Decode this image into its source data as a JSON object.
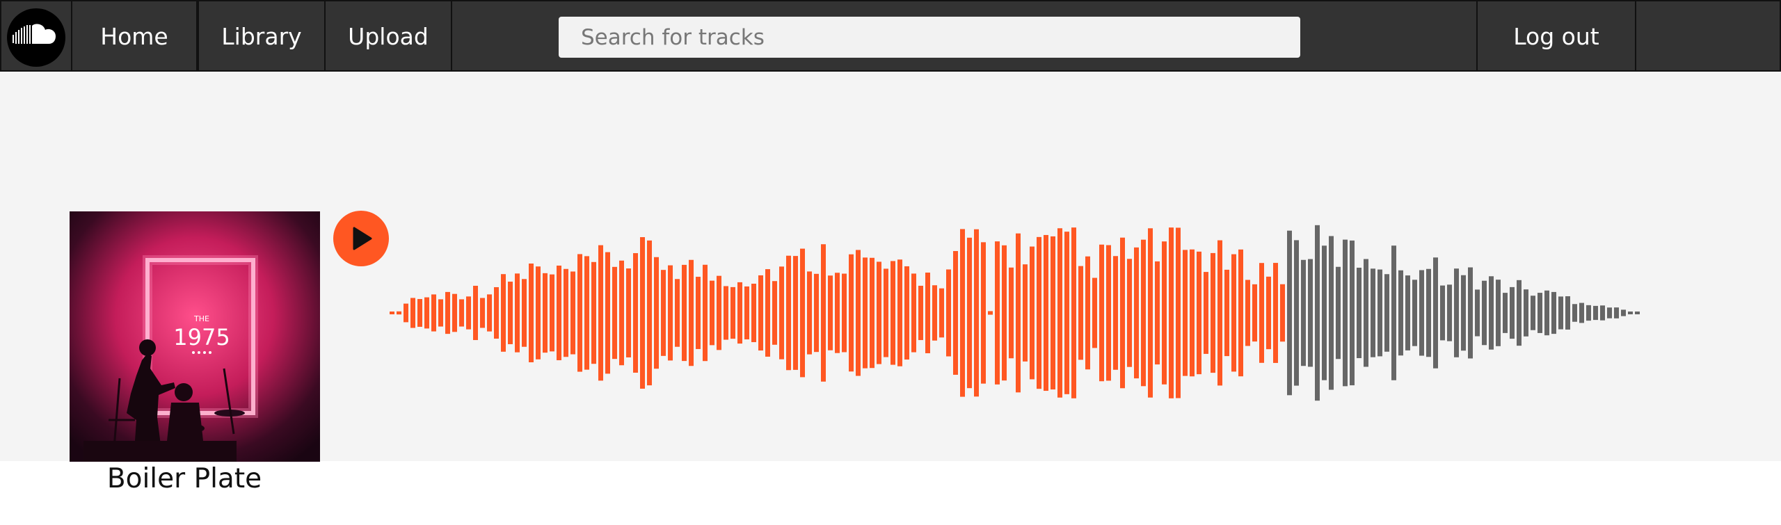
{
  "nav": {
    "logo_icon": "soundcloud-cloud-icon",
    "home": "Home",
    "library": "Library",
    "upload": "Upload",
    "search_placeholder": "Search for tracks",
    "logout": "Log out"
  },
  "track": {
    "title": "Boiler Plate",
    "cover": {
      "band_the": "THE",
      "band_name": "1975"
    },
    "play_icon": "play-icon",
    "progress": 0.717
  },
  "colors": {
    "accent": "#ff5722",
    "navbar": "#333333",
    "played": "#ff5722",
    "unplayed": "#666666",
    "background": "#f4f4f4"
  }
}
